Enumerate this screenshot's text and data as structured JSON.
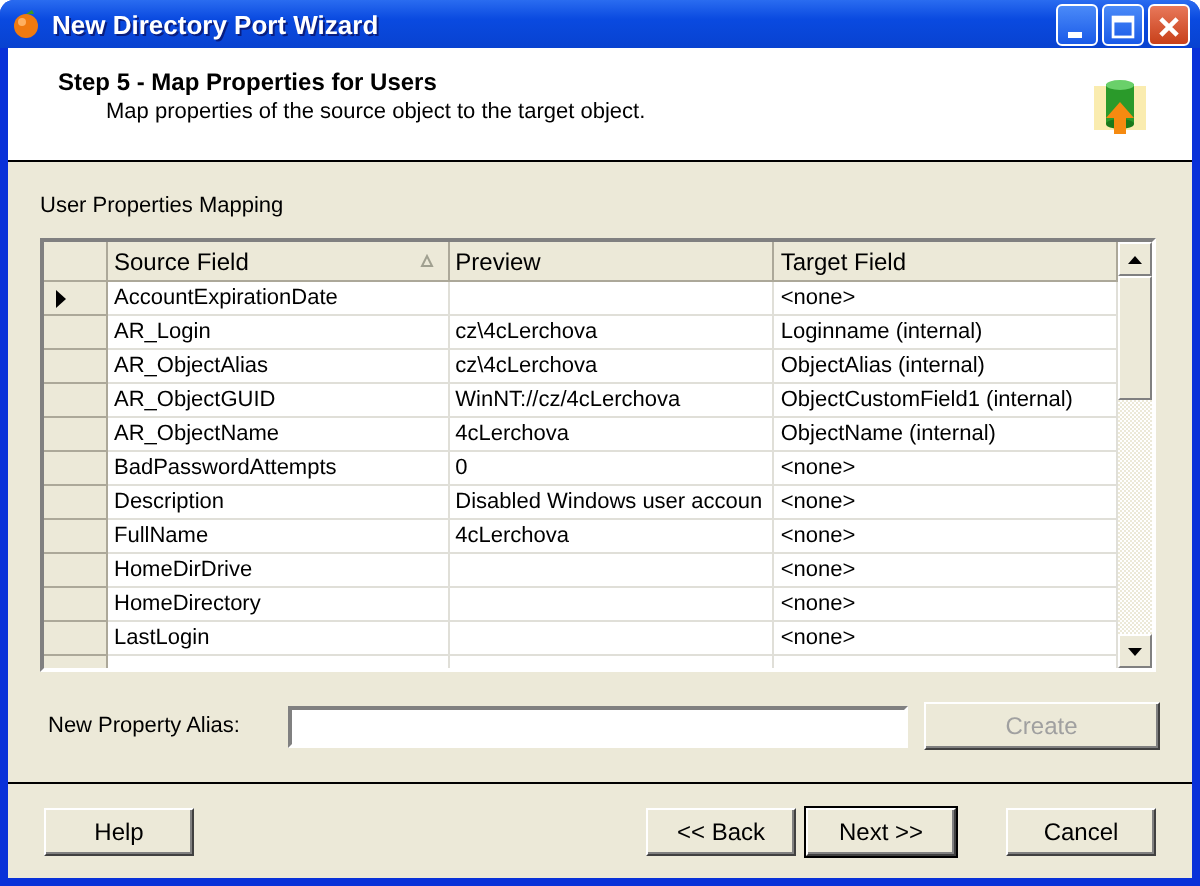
{
  "window": {
    "title": "New Directory Port Wizard"
  },
  "header": {
    "title": "Step 5 - Map Properties for Users",
    "subtitle": "Map properties of the source object to the target object."
  },
  "section_label": "User Properties Mapping",
  "table": {
    "columns": [
      {
        "label": "Source Field",
        "sorted": true
      },
      {
        "label": "Preview",
        "sorted": false
      },
      {
        "label": "Target Field",
        "sorted": false
      }
    ],
    "rows": [
      {
        "selected": true,
        "cells": [
          "AccountExpirationDate",
          "",
          "<none>"
        ]
      },
      {
        "selected": false,
        "cells": [
          "AR_Login",
          "cz\\4cLerchova",
          "Loginname (internal)"
        ]
      },
      {
        "selected": false,
        "cells": [
          "AR_ObjectAlias",
          "cz\\4cLerchova",
          "ObjectAlias (internal)"
        ]
      },
      {
        "selected": false,
        "cells": [
          "AR_ObjectGUID",
          "WinNT://cz/4cLerchova",
          "ObjectCustomField1  (internal)"
        ]
      },
      {
        "selected": false,
        "cells": [
          "AR_ObjectName",
          "4cLerchova",
          "ObjectName (internal)"
        ]
      },
      {
        "selected": false,
        "cells": [
          "BadPasswordAttempts",
          "0",
          "<none>"
        ]
      },
      {
        "selected": false,
        "cells": [
          "Description",
          "Disabled Windows user accoun",
          "<none>"
        ]
      },
      {
        "selected": false,
        "cells": [
          "FullName",
          "4cLerchova",
          "<none>"
        ]
      },
      {
        "selected": false,
        "cells": [
          "HomeDirDrive",
          "",
          "<none>"
        ]
      },
      {
        "selected": false,
        "cells": [
          "HomeDirectory",
          "",
          "<none>"
        ]
      },
      {
        "selected": false,
        "cells": [
          "LastLogin",
          "",
          "<none>"
        ]
      }
    ]
  },
  "alias": {
    "label": "New Property Alias:",
    "button": {
      "label": "Create",
      "disabled": true
    }
  },
  "buttons": [
    {
      "label": "Help",
      "default": false,
      "disabled": false
    },
    {
      "label": "<< Back",
      "default": false,
      "disabled": false
    },
    {
      "label": "Next >>",
      "default": true,
      "disabled": false
    },
    {
      "label": "Cancel",
      "default": false,
      "disabled": false
    }
  ]
}
